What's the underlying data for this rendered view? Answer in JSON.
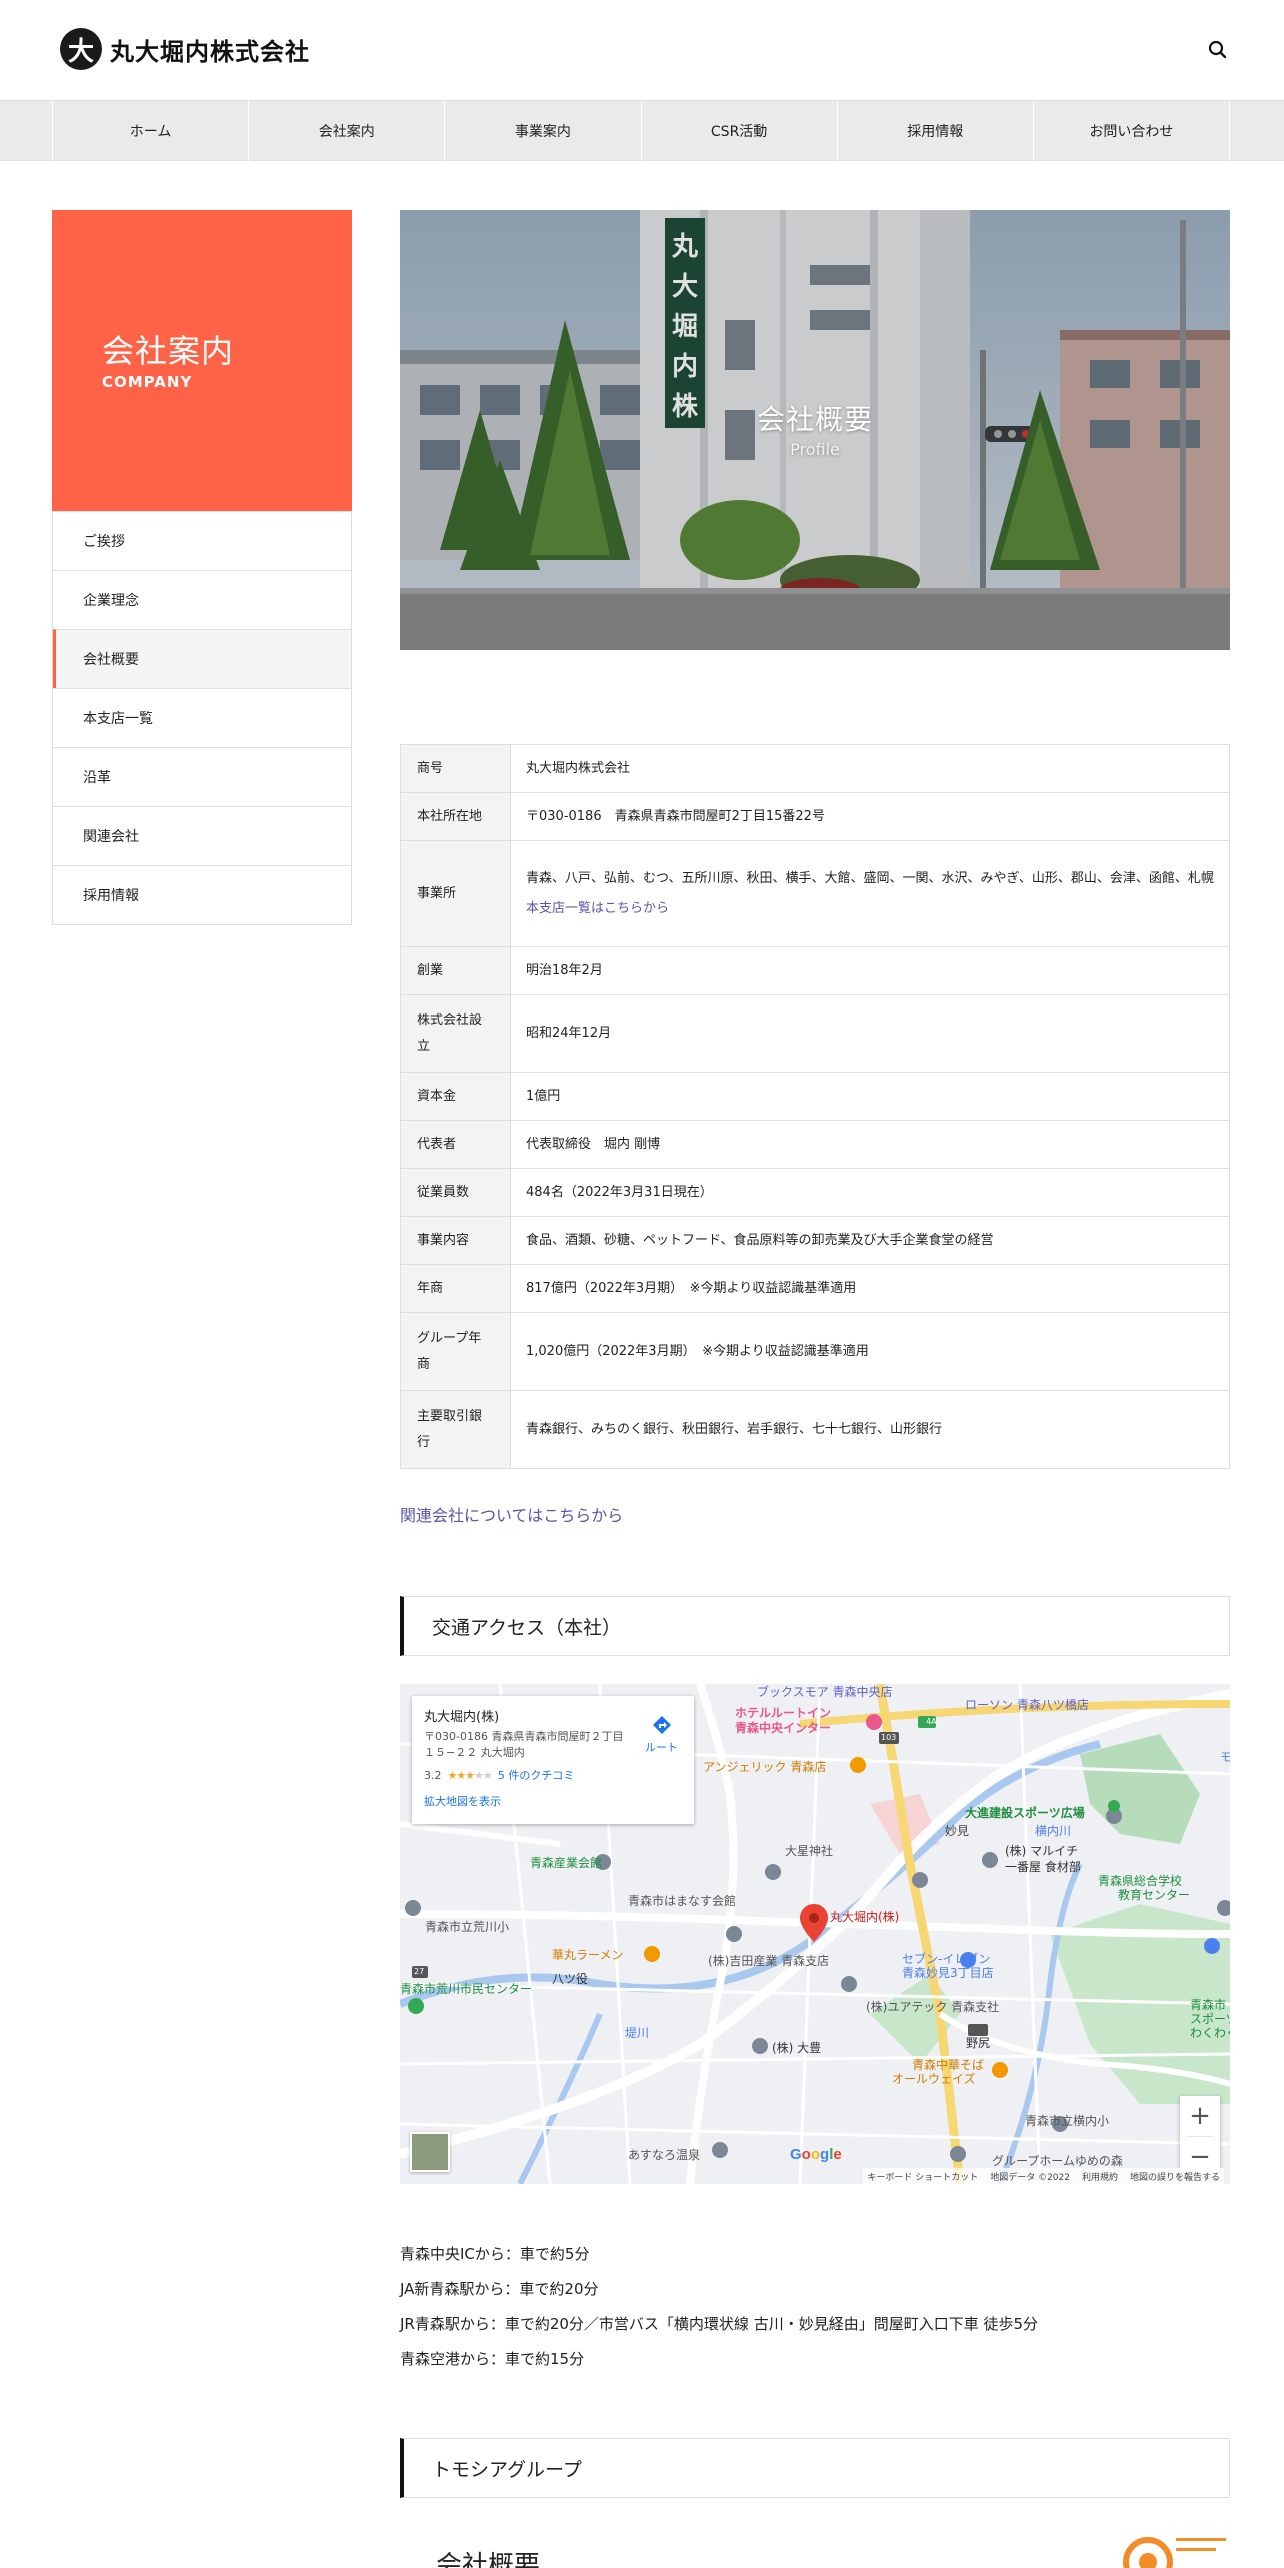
{
  "header": {
    "logo_mark": "大",
    "logo_text": "丸大堀内株式会社",
    "search_icon": "search-icon"
  },
  "nav": {
    "items": [
      {
        "label": "ホーム"
      },
      {
        "label": "会社案内"
      },
      {
        "label": "事業案内"
      },
      {
        "label": "CSR活動"
      },
      {
        "label": "採用情報"
      },
      {
        "label": "お問い合わせ"
      }
    ]
  },
  "sidebar": {
    "title": "会社案内",
    "subtitle": "COMPANY",
    "accent_color": "#ff6347",
    "items": [
      {
        "label": "ご挨拶"
      },
      {
        "label": "企業理念"
      },
      {
        "label": "会社概要"
      },
      {
        "label": "本支店一覧"
      },
      {
        "label": "沿革"
      },
      {
        "label": "関連会社"
      },
      {
        "label": "採用情報"
      }
    ],
    "active_index": 2
  },
  "hero": {
    "title": "会社概要",
    "subtitle": "Profile",
    "sign_text": "丸大堀内株"
  },
  "profile": {
    "rows": [
      {
        "label": "商号",
        "value": "丸大堀内株式会社"
      },
      {
        "label": "本社所在地",
        "value": "〒030-0186　青森県青森市問屋町2丁目15番22号"
      },
      {
        "label": "事業所",
        "value": "青森、八戸、弘前、むつ、五所川原、秋田、横手、大館、盛岡、一関、水沢、みやぎ、山形、郡山、会津、函館、札幌",
        "link": "本支店一覧はこちらから"
      },
      {
        "label": "創業",
        "value": "明治18年2月"
      },
      {
        "label": "株式会社設立",
        "value": "昭和24年12月"
      },
      {
        "label": "資本金",
        "value": "1億円"
      },
      {
        "label": "代表者",
        "value": "代表取締役　堀内 剛博"
      },
      {
        "label": "従業員数",
        "value": "484名（2022年3月31日現在）"
      },
      {
        "label": "事業内容",
        "value": "食品、酒類、砂糖、ペットフード、食品原料等の卸売業及び大手企業食堂の経営"
      },
      {
        "label": "年商",
        "value": "817億円（2022年3月期）　※今期より収益認識基準適用"
      },
      {
        "label": "グループ年商",
        "value": "1,020億円（2022年3月期）　※今期より収益認識基準適用"
      },
      {
        "label": "主要取引銀行",
        "value": "青森銀行、みちのく銀行、秋田銀行、岩手銀行、七十七銀行、山形銀行"
      }
    ]
  },
  "related_link": "関連会社についてはこちらから",
  "access": {
    "heading": "交通アクセス（本社）",
    "lines": [
      "青森中央ICから：車で約5分",
      "JA新青森駅から：車で約20分",
      "JR青森駅から：車で約20分／市営バス「横内環状線 古川・妙見経由」問屋町入口下車 徒歩5分",
      "青森空港から：車で約15分"
    ]
  },
  "map": {
    "card_title": "丸大堀内(株)",
    "card_address": "〒030-0186 青森県青森市問屋町２丁目１５−２２ 丸大堀内",
    "rating": "3.2",
    "rating_stars": 3,
    "reviews": "5 件のクチコミ",
    "route_label": "ルート",
    "larger_map": "拡大地図を表示",
    "pin_label": "丸大堀内(株)",
    "zoom_in": "+",
    "zoom_out": "−",
    "google": "Google",
    "footer": [
      "キーボード ショートカット",
      "地図データ ©2022",
      "利用規約",
      "地図の誤りを報告する"
    ],
    "labels": [
      {
        "text": "ブックスモア 青森中央店"
      },
      {
        "text": "ホテルルートイン"
      },
      {
        "text": "青森中央インター"
      },
      {
        "text": "ローソン 青森八ツ橋店"
      },
      {
        "text": "アンジェリック 青森店"
      },
      {
        "text": "大進建設スポーツ広場"
      },
      {
        "text": "横内川"
      },
      {
        "text": "妙見"
      },
      {
        "text": "大星神社"
      },
      {
        "text": "(株) マルイチ"
      },
      {
        "text": "一番屋 食材部"
      },
      {
        "text": "青森県総合学校"
      },
      {
        "text": "教育センター"
      },
      {
        "text": "青森産業会館"
      },
      {
        "text": "青森市はまなす会館"
      },
      {
        "text": "青森市立荒川小"
      },
      {
        "text": "華丸ラーメン"
      },
      {
        "text": "八ツ役"
      },
      {
        "text": "(株)吉田産業 青森支店"
      },
      {
        "text": "セブン-イレブン"
      },
      {
        "text": "青森妙見3丁目店"
      },
      {
        "text": "(株)ユアテック 青森支社"
      },
      {
        "text": "青森市荒川市民センター"
      },
      {
        "text": "青森市"
      },
      {
        "text": "スポーツ公"
      },
      {
        "text": "わくわく広"
      },
      {
        "text": "(株) 大豊"
      },
      {
        "text": "野尻"
      },
      {
        "text": "青森中華そば"
      },
      {
        "text": "オールウェイズ"
      },
      {
        "text": "青森市立横内小"
      },
      {
        "text": "あすなろ温泉"
      },
      {
        "text": "グループホームゆめの森"
      },
      {
        "text": "堤川"
      },
      {
        "text": "4A"
      },
      {
        "text": "103"
      },
      {
        "text": "27"
      },
      {
        "text": "モ"
      }
    ]
  },
  "group": {
    "heading": "トモシアグループ",
    "sub_title": "会社概要"
  }
}
